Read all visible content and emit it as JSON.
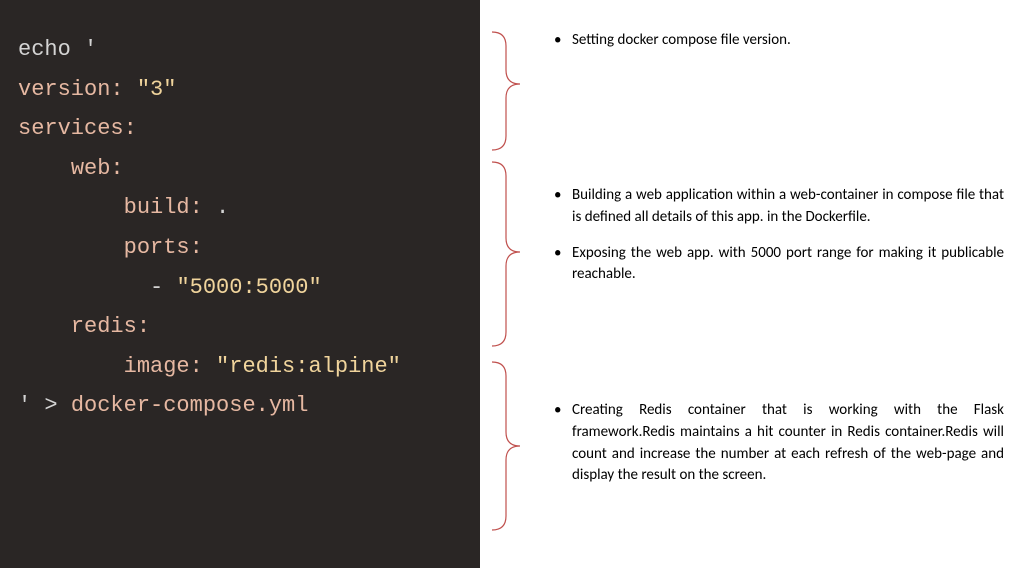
{
  "code": {
    "l1_echo": "echo",
    "l1_quote": " '",
    "l2_key": "version:",
    "l2_val": " \"3\"",
    "l3_key": "services:",
    "l4_key": "web:",
    "l5_key": "build:",
    "l5_val": " .",
    "l6_key": "ports:",
    "l7_dash": "- ",
    "l7_val": "\"5000:5000\"",
    "l8_key": "redis:",
    "l9_key": "image:",
    "l9_val": " \"redis:alpine\"",
    "l10_quote": "'",
    "l10_op": " > ",
    "l10_file": "docker-compose.yml"
  },
  "annotations": {
    "group1": {
      "items": [
        "Setting  docker compose  file version."
      ]
    },
    "group2": {
      "items": [
        "Building a web application within a web-container in compose file that is defined all details of this app. in the Dockerfile.",
        "Exposing the web app. with 5000 port range for making it publicable reachable."
      ]
    },
    "group3": {
      "items": [
        "Creating   Redis container that is working with the Flask framework.Redis maintains a hit counter in Redis container.Redis will count and increase the number at each  refresh of the web-page and display the result on the screen."
      ]
    }
  },
  "colors": {
    "code_bg": "#2a2625",
    "bracket": "#c0504d",
    "key": "#e6b8a2",
    "string": "#f0d49c"
  }
}
